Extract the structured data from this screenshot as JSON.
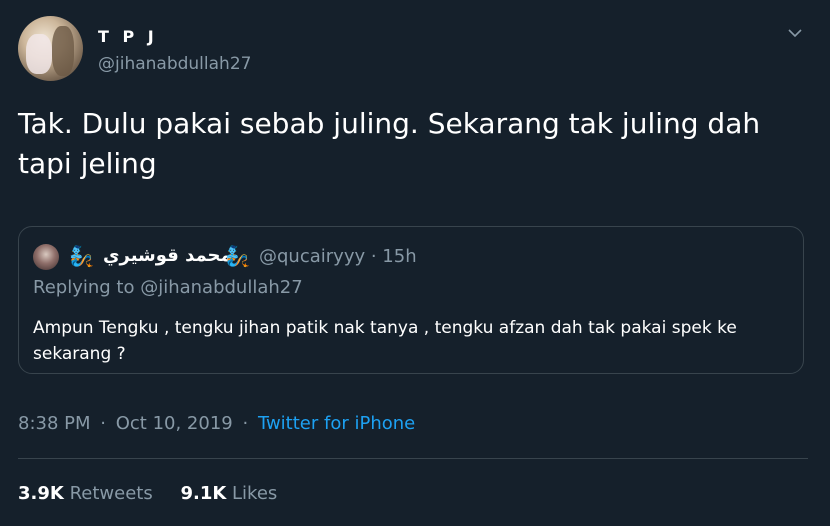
{
  "user": {
    "display_name": "T P J",
    "handle": "@jihanabdullah27",
    "avatar_icon": "profile-photo"
  },
  "tweet": {
    "text": "Tak. Dulu pakai sebab juling. Sekarang tak juling dah tapi jeling"
  },
  "quoted": {
    "emoji": "🧞",
    "display_name": "محمد قوشيري",
    "meta": "@qucairyyy · 15h",
    "replying_to": "Replying to @jihanabdullah27",
    "text": "Ampun Tengku , tengku jihan patik nak tanya , tengku afzan dah tak pakai spek ke sekarang ?"
  },
  "timestamp": {
    "time": "8:38 PM",
    "separator": "·",
    "date": "Oct 10, 2019",
    "source": "Twitter for iPhone"
  },
  "stats": {
    "retweets_count": "3.9K",
    "retweets_label": "Retweets",
    "likes_count": "9.1K",
    "likes_label": "Likes"
  },
  "colors": {
    "background": "#15202b",
    "secondary_text": "#8899a6",
    "link": "#1da1f2",
    "border": "#38444d"
  }
}
